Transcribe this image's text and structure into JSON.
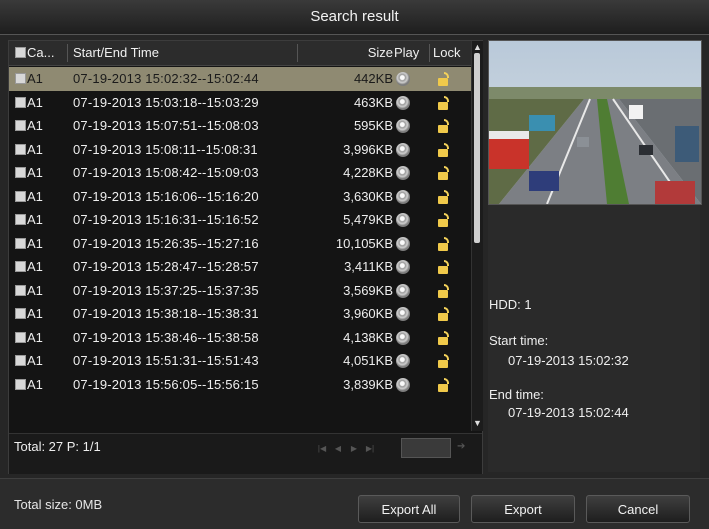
{
  "dialog": {
    "title": "Search result"
  },
  "table": {
    "columns": {
      "camera": "Ca...",
      "time": "Start/End Time",
      "size": "Size",
      "play": "Play",
      "lock": "Lock"
    },
    "rows": [
      {
        "camera": "A1",
        "time": "07-19-2013 15:02:32--15:02:44",
        "size": "442KB",
        "selected": true
      },
      {
        "camera": "A1",
        "time": "07-19-2013 15:03:18--15:03:29",
        "size": "463KB"
      },
      {
        "camera": "A1",
        "time": "07-19-2013 15:07:51--15:08:03",
        "size": "595KB"
      },
      {
        "camera": "A1",
        "time": "07-19-2013 15:08:11--15:08:31",
        "size": "3,996KB"
      },
      {
        "camera": "A1",
        "time": "07-19-2013 15:08:42--15:09:03",
        "size": "4,228KB"
      },
      {
        "camera": "A1",
        "time": "07-19-2013 15:16:06--15:16:20",
        "size": "3,630KB"
      },
      {
        "camera": "A1",
        "time": "07-19-2013 15:16:31--15:16:52",
        "size": "5,479KB"
      },
      {
        "camera": "A1",
        "time": "07-19-2013 15:26:35--15:27:16",
        "size": "10,105KB"
      },
      {
        "camera": "A1",
        "time": "07-19-2013 15:28:47--15:28:57",
        "size": "3,411KB"
      },
      {
        "camera": "A1",
        "time": "07-19-2013 15:37:25--15:37:35",
        "size": "3,569KB"
      },
      {
        "camera": "A1",
        "time": "07-19-2013 15:38:18--15:38:31",
        "size": "3,960KB"
      },
      {
        "camera": "A1",
        "time": "07-19-2013 15:38:46--15:38:58",
        "size": "4,138KB"
      },
      {
        "camera": "A1",
        "time": "07-19-2013 15:51:31--15:51:43",
        "size": "4,051KB"
      },
      {
        "camera": "A1",
        "time": "07-19-2013 15:56:05--15:56:15",
        "size": "3,839KB"
      }
    ],
    "footer": {
      "total": "Total: 27  P: 1/1"
    }
  },
  "details": {
    "hdd": "HDD: 1",
    "start_label": "Start time:",
    "start_value": "07-19-2013 15:02:32",
    "end_label": "End time:",
    "end_value": "07-19-2013 15:02:44"
  },
  "bottom": {
    "total_size": "Total size: 0MB",
    "export_all": "Export All",
    "export": "Export",
    "cancel": "Cancel"
  },
  "colors": {
    "selected_row": "#8f8a72",
    "background": "#262626"
  }
}
